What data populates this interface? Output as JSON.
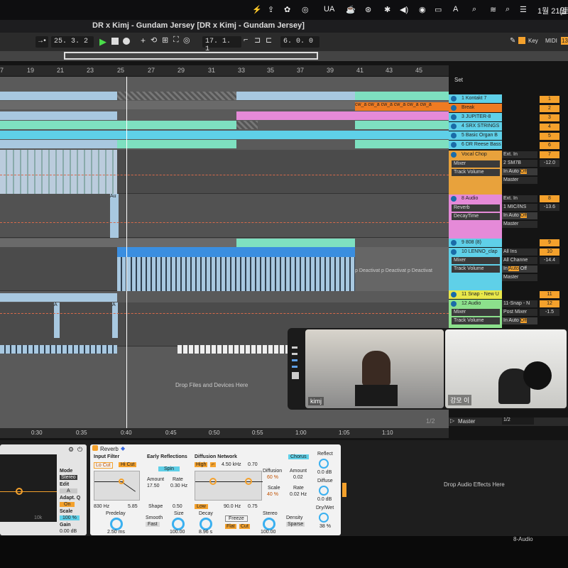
{
  "menubar": {
    "input_source": "UA",
    "date": "1월 21일",
    "extra": "(토"
  },
  "window": {
    "title": "DR x Kimj - Gundam Jersey  [DR x Kimj - Gundam Jersey]"
  },
  "transport": {
    "position": "25. 3. 2",
    "loop_start": "17. 1. 1",
    "loop_length": "6. 0. 0",
    "key_label": "Key",
    "midi_label": "MIDI",
    "midi_value": "13"
  },
  "ruler": {
    "bars": [
      "7",
      "19",
      "21",
      "23",
      "25",
      "27",
      "29",
      "31",
      "33",
      "35",
      "37",
      "39",
      "41",
      "43",
      "45"
    ]
  },
  "time_ruler": {
    "marks": [
      "0:30",
      "0:35",
      "0:40",
      "0:45",
      "0:50",
      "0:55",
      "1:00",
      "1:05",
      "1:10"
    ]
  },
  "set_label": "Set",
  "tracks": [
    {
      "name": "1 Kontakt 7",
      "color": "#5fd0e8",
      "num": "1"
    },
    {
      "name": "Break",
      "color": "#ef7b22",
      "num": "2"
    },
    {
      "name": "3 JUPITER-8",
      "color": "#5fd0e8",
      "num": "3"
    },
    {
      "name": "4 SRX STRINGS",
      "color": "#5fd0e8",
      "num": "4"
    },
    {
      "name": "5 Basic Organ B",
      "color": "#5fd0e8",
      "num": "5"
    },
    {
      "name": "6 DR Reese Bass",
      "color": "#5fd0e8",
      "num": "6"
    },
    {
      "name": "Vocal Chop",
      "color": "#e8a23c",
      "num": "7"
    },
    {
      "name": "8 Audio",
      "color": "#e58ad8",
      "num": "8"
    },
    {
      "name": "9 808 (8)",
      "color": "#5fd0e8",
      "num": "9"
    },
    {
      "name": "10 LENNO_clap",
      "color": "#5fd0e8",
      "num": "10"
    },
    {
      "name": "11 Snap - New U",
      "color": "#e8e84a",
      "num": "11"
    },
    {
      "name": "12 Audio",
      "color": "#8ce08c",
      "num": "12"
    }
  ],
  "track_io": {
    "vocal": {
      "in": "Ext. In",
      "ch": "2 SM7B",
      "out": "Master",
      "vol": "-12.0",
      "mixer": "Mixer",
      "param": "Track Volume"
    },
    "audio8": {
      "in": "Ext. In",
      "ch": "1 MIC/INS",
      "out": "Master",
      "vol": "-13.6",
      "mixer": "Reverb",
      "param": "DecayTime"
    },
    "clap": {
      "in": "All Ins",
      "ch": "All Channe",
      "out": "Master",
      "vol": "-14.4",
      "mixer": "Mixer",
      "param": "Track Volume"
    },
    "audio12": {
      "in": "11-Snap - N",
      "ch": "Post Mixer",
      "vol": "-1.5",
      "mixer": "Mixer",
      "param": "Track Volume"
    },
    "monitor": {
      "in": "In",
      "auto": "Auto",
      "off": "Off"
    }
  },
  "clip_labels": {
    "cw": "cw_a",
    "deact": "p Deactivat",
    "au": "Au",
    "a": "A"
  },
  "drop_files": "Drop Files and Devices Here",
  "master": {
    "name": "Master",
    "routing": "1/2",
    "page": "1/2"
  },
  "video": {
    "person1": "kimj",
    "person2": "강모 이"
  },
  "reverb": {
    "title": "Reverb",
    "input_filter": "Input Filter",
    "lo_cut": "Lo Cut",
    "hi_cut": "Hi Cut",
    "freq1": "830 Hz",
    "q": "5.85",
    "early": "Early Reflections",
    "spin": "Spin",
    "amount_l": "Amount",
    "amount": "17.50",
    "rate_l": "Rate",
    "rate": "0.30 Hz",
    "shape_l": "Shape",
    "shape": "0.50",
    "diffusion": "Diffusion Network",
    "high": "High",
    "high_freq": "4.50 kHz",
    "high_val": "0.70",
    "low": "Low",
    "low_freq": "90.0 Hz",
    "low_val": "0.75",
    "diff_l": "Diffusion",
    "diff": "60 %",
    "scale_l": "Scale",
    "scale": "40 %",
    "chorus": "Chorus",
    "ch_amount_l": "Amount",
    "ch_amount": "0.02",
    "ch_rate_l": "Rate",
    "ch_rate": "0.02 Hz",
    "reflect_l": "Reflect",
    "reflect": "0.0 dB",
    "diffuse_l": "Diffuse",
    "diffuse": "0.0 dB",
    "drywet_l": "Dry/Wet",
    "drywet": "38 %",
    "predelay_l": "Predelay",
    "predelay": "2.50 ms",
    "smooth_l": "Smooth",
    "smooth": "Fast",
    "size_l": "Size",
    "size": "100.00",
    "decay_l": "Decay",
    "decay": "8.96 s",
    "freeze": "Freeze",
    "flat": "Flat",
    "cut": "Cut",
    "stereo_l": "Stereo",
    "stereo": "100.00",
    "density_l": "Density",
    "density": "Sparse"
  },
  "eq": {
    "mode_l": "Mode",
    "mode": "Stereo",
    "edit_l": "Edit",
    "edit": "A",
    "adapt_l": "Adapt. Q",
    "adapt": "On",
    "scale_l": "Scale",
    "scale": "100 %",
    "gain_l": "Gain",
    "gain": "0.00 dB",
    "freq": "10k"
  },
  "drop_audio": "Drop Audio Effects Here",
  "status_track": "8-Audio"
}
